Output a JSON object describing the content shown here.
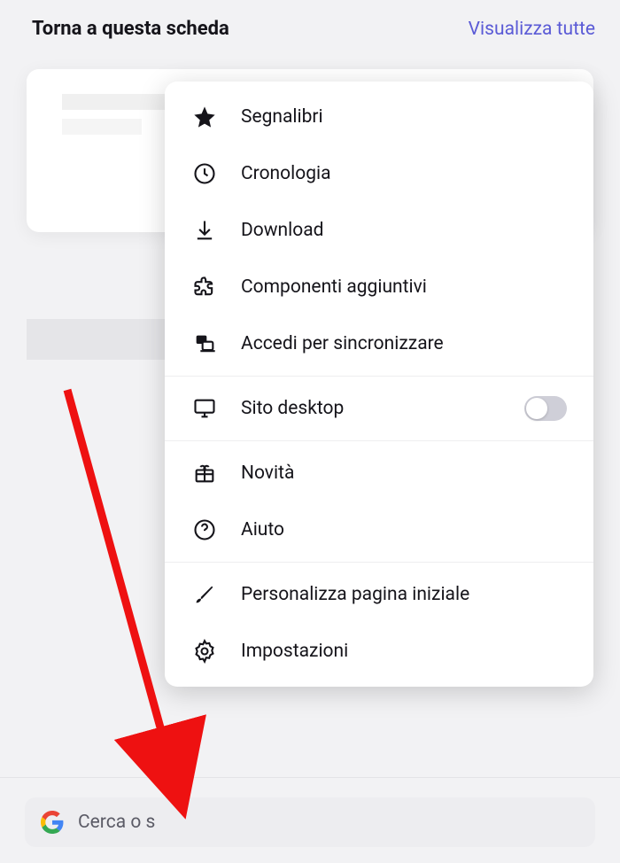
{
  "header": {
    "title": "Torna a questa scheda",
    "view_all": "Visualizza tutte"
  },
  "search": {
    "placeholder_partial": "Cerca o s"
  },
  "menu": {
    "bookmarks": "Segnalibri",
    "history": "Cronologia",
    "download": "Download",
    "addons": "Componenti aggiuntivi",
    "sync": "Accedi per sincronizzare",
    "desktop_site": "Sito desktop",
    "whats_new": "Novità",
    "help": "Aiuto",
    "customize_home": "Personalizza pagina iniziale",
    "settings": "Impostazioni"
  }
}
